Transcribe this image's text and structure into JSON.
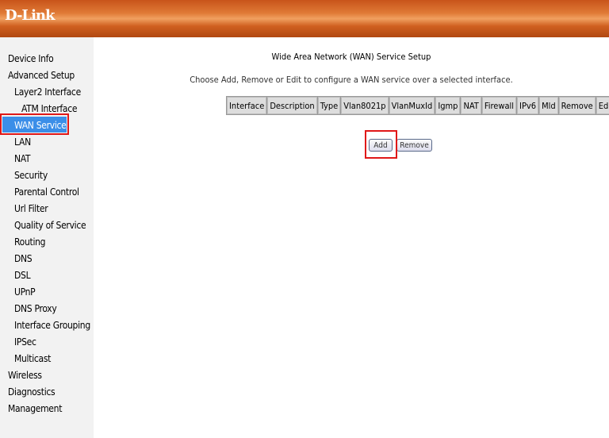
{
  "header": {
    "logo": "D-Link"
  },
  "sidebar": {
    "items": [
      {
        "label": "Device Info",
        "level": 0
      },
      {
        "label": "Advanced Setup",
        "level": 0
      },
      {
        "label": "Layer2 Interface",
        "level": 1
      },
      {
        "label": "ATM Interface",
        "level": 2
      },
      {
        "label": "WAN Service",
        "level": 1,
        "selected": true
      },
      {
        "label": "LAN",
        "level": 1
      },
      {
        "label": "NAT",
        "level": 1
      },
      {
        "label": "Security",
        "level": 1
      },
      {
        "label": "Parental Control",
        "level": 1
      },
      {
        "label": "Url Filter",
        "level": 1
      },
      {
        "label": "Quality of Service",
        "level": 1
      },
      {
        "label": "Routing",
        "level": 1
      },
      {
        "label": "DNS",
        "level": 1
      },
      {
        "label": "DSL",
        "level": 1
      },
      {
        "label": "UPnP",
        "level": 1
      },
      {
        "label": "DNS Proxy",
        "level": 1
      },
      {
        "label": "Interface Grouping",
        "level": 1
      },
      {
        "label": "IPSec",
        "level": 1
      },
      {
        "label": "Multicast",
        "level": 1
      },
      {
        "label": "Wireless",
        "level": 0
      },
      {
        "label": "Diagnostics",
        "level": 0
      },
      {
        "label": "Management",
        "level": 0
      }
    ]
  },
  "main": {
    "title": "Wide Area Network (WAN) Service Setup",
    "description": "Choose Add, Remove or Edit to configure a WAN service over a selected interface.",
    "table": {
      "columns": [
        "Interface",
        "Description",
        "Type",
        "Vlan8021p",
        "VlanMuxId",
        "Igmp",
        "NAT",
        "Firewall",
        "IPv6",
        "Mld",
        "Remove",
        "Edit"
      ],
      "rows": []
    },
    "add_label": "Add",
    "remove_label": "Remove"
  },
  "colors": {
    "highlight": "#e01818",
    "selected": "#3b8ee8"
  }
}
